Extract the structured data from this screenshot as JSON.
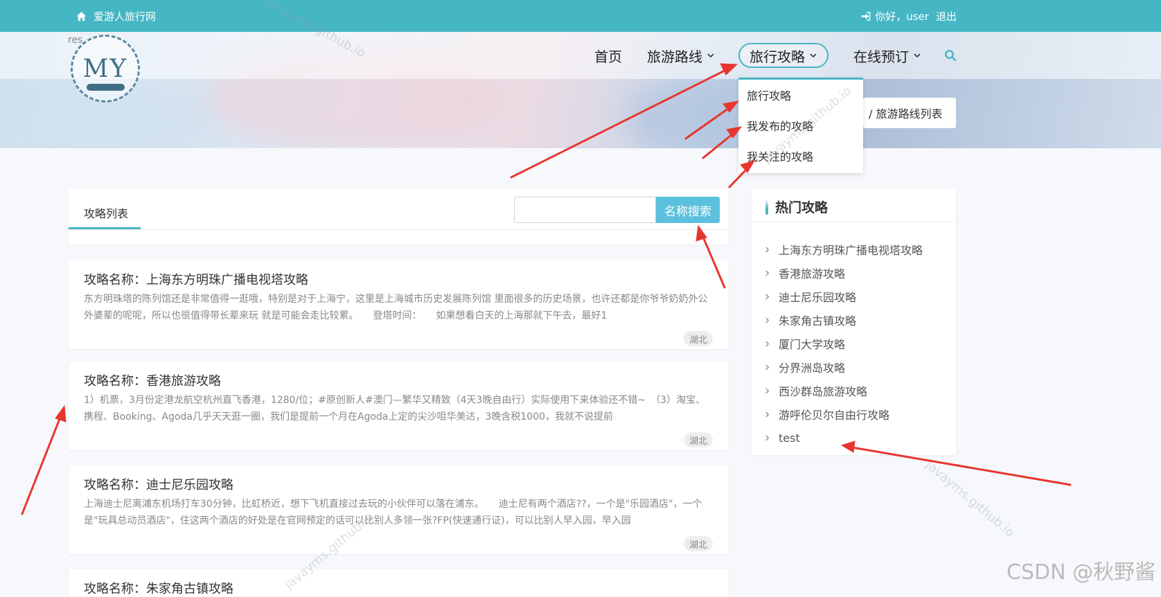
{
  "topbar": {
    "home_text": "爱游人旅行网",
    "greeting": "你好，user",
    "logout": "退出"
  },
  "logo": {
    "text": "MY",
    "prefix": "res"
  },
  "nav": {
    "home": "首页",
    "routes": "旅游路线",
    "guides": "旅行攻略",
    "booking": "在线预订"
  },
  "dropdown": [
    "旅行攻略",
    "我发布的攻略",
    "我关注的攻略"
  ],
  "breadcrumb": "/  旅游路线列表",
  "panel": {
    "tab_label": "攻略列表",
    "search_button": "名称搜索",
    "search_value": ""
  },
  "cards": [
    {
      "title": "攻略名称：上海东方明珠广播电视塔攻略",
      "desc": "东方明珠塔的陈列馆还是非常值得一逛哦，特别是对于上海宁，这里是上海城市历史发展陈列馆 里面很多的历史场景，也许还都是你爷爷奶奶外公外婆辈的呢呢，所以也很值得带长辈来玩 就是可能会走比较累。　　登塔时间：　　如果想看白天的上海那就下午去，最好1",
      "tag": "湖北"
    },
    {
      "title": "攻略名称：香港旅游攻略",
      "desc": "1）机票，3月份定港龙航空杭州直飞香港，1280/位；#原创新人#澳门—繁华又精致（4天3晚自由行）实际使用下来体验还不错~　（3）淘宝、携程、Booking、Agoda几乎天天逛一圈，我们是提前一个月在Agoda上定的尖沙咀华美达，3晚含税1000，我就不说提前",
      "tag": "湖北"
    },
    {
      "title": "攻略名称：迪士尼乐园攻略",
      "desc": "上海迪士尼离浦东机场打车30分钟，比虹桥近，想下飞机直接过去玩的小伙伴可以落在浦东。　　迪士尼有两个酒店??，一个是\"乐园酒店\"，一个是\"玩具总动员酒店\"，住这两个酒店的好处是在官网预定的话可以比别人多领一张?FP(快速通行证)，可以比别人早入园，早入园",
      "tag": "湖北"
    },
    {
      "title": "攻略名称：朱家角古镇攻略",
      "desc": "",
      "tag": ""
    }
  ],
  "sidebar": {
    "title": "热门攻略",
    "items": [
      "上海东方明珠广播电视塔攻略",
      "香港旅游攻略",
      "迪士尼乐园攻略",
      "朱家角古镇攻略",
      "厦门大学攻略",
      "分界洲岛攻略",
      "西沙群岛旅游攻略",
      "游呼伦贝尔自由行攻略",
      "test"
    ]
  },
  "watermarks": [
    "javayms.github.io",
    "javayms.github.io",
    "javayms.github.io",
    "javayms.github.io"
  ],
  "footer_mark": "CSDN @秋野酱",
  "colors": {
    "accent": "#45b6c4",
    "search_button": "#5bc0de",
    "arrow": "#e8352e"
  }
}
